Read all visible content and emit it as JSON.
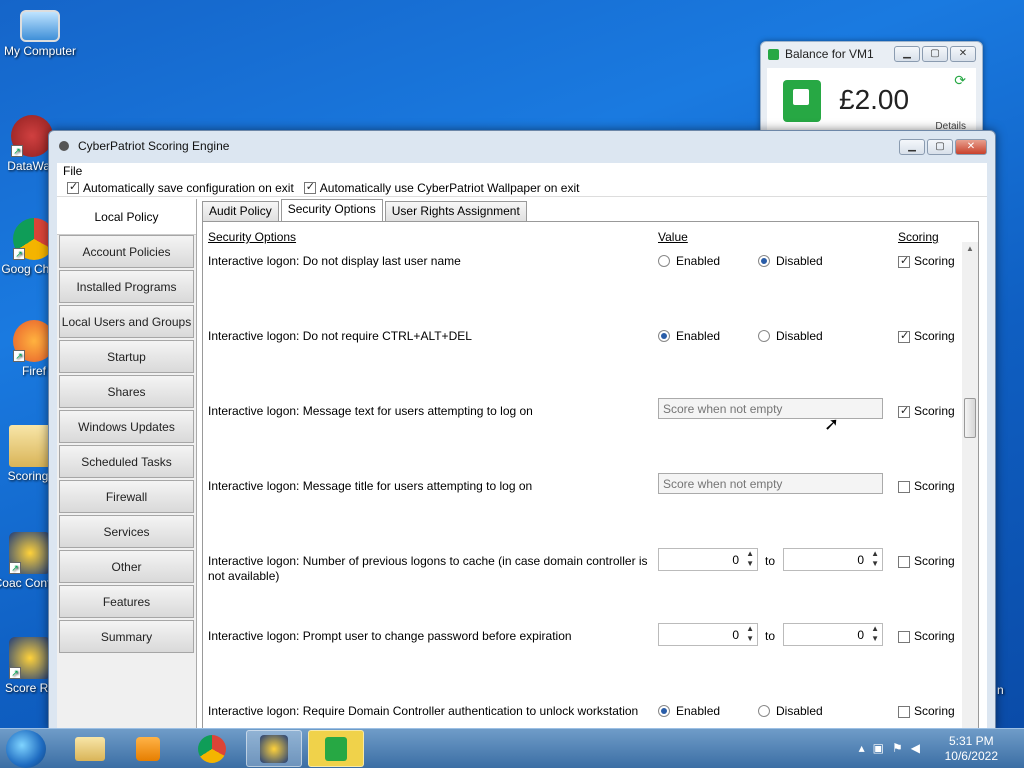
{
  "desktop": {
    "icons": [
      {
        "label": "My Computer"
      },
      {
        "label": "DataWag"
      },
      {
        "label": "Goog Chron"
      },
      {
        "label": "Firef"
      },
      {
        "label": "Scoring-"
      },
      {
        "label": "Coac Configu"
      },
      {
        "label": "Score Re"
      }
    ],
    "right_partial": "n"
  },
  "balance_window": {
    "title": "Balance for VM1",
    "amount": "£2.00",
    "details": "Details",
    "brand_color": "#27a844"
  },
  "main_window": {
    "title": "CyberPatriot Scoring Engine",
    "menu": {
      "file": "File"
    },
    "options": {
      "auto_save": "Automatically save configuration on exit",
      "auto_wallpaper": "Automatically use CyberPatriot Wallpaper on exit"
    },
    "nav": {
      "active": "Local Policy",
      "items": [
        "Account Policies",
        "Installed Programs",
        "Local Users and Groups",
        "Startup",
        "Shares",
        "Windows Updates",
        "Scheduled Tasks",
        "Firewall",
        "Services",
        "Other",
        "Features",
        "Summary"
      ]
    },
    "tabs": [
      "Audit Policy",
      "Security Options",
      "User Rights Assignment"
    ],
    "active_tab": "Security Options",
    "headers": {
      "option": "Security Options",
      "value": "Value",
      "scoring": "Scoring"
    },
    "common": {
      "enabled": "Enabled",
      "disabled": "Disabled",
      "scoring": "Scoring",
      "to": "to",
      "placeholder": "Score when not empty"
    },
    "rows": [
      {
        "label": "Interactive logon: Do not display last user name",
        "value": "Disabled",
        "scoring": true
      },
      {
        "label": "Interactive logon: Do not require CTRL+ALT+DEL",
        "value": "Enabled",
        "scoring": true
      },
      {
        "label": "Interactive logon: Message text for users attempting to log on",
        "scoring": true
      },
      {
        "label": "Interactive logon: Message title for users attempting to log on",
        "scoring": false
      },
      {
        "label": "Interactive logon: Number of previous logons to cache (in case domain controller is not available)",
        "min": "0",
        "max": "0",
        "scoring": false
      },
      {
        "label": "Interactive logon: Prompt user to change password before expiration",
        "min": "0",
        "max": "0",
        "scoring": false
      },
      {
        "label": "Interactive logon: Require Domain Controller authentication to unlock workstation",
        "value": "Enabled",
        "scoring": false
      }
    ]
  },
  "taskbar": {
    "time": "5:31 PM",
    "date": "10/6/2022"
  }
}
